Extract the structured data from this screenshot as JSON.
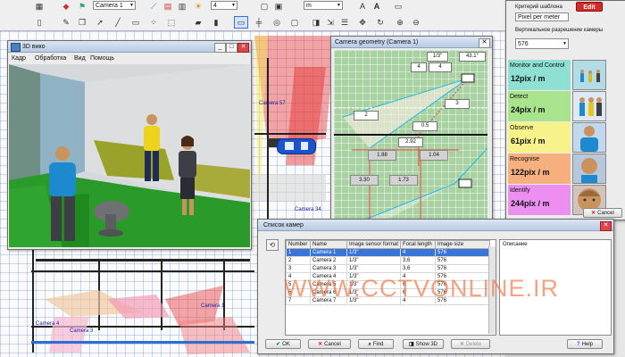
{
  "toolbar": {
    "camera_select": "Camera 1",
    "number_select": "4",
    "unit_select": "m"
  },
  "map": {
    "camera_labels": [
      "Camera 57",
      "Camera 34",
      "Camera 1",
      "Camera 3",
      "Camera 4"
    ]
  },
  "view3d": {
    "title": "3D вико",
    "menu": [
      "Кадр",
      "Обработка",
      "Вид",
      "Помощь"
    ]
  },
  "geometry": {
    "title": "Camera geometry (Camera 1)",
    "sensor": "1/3\"",
    "angle": "43.1°",
    "focal_select": "4",
    "focal_value": "4",
    "height_select": "2",
    "distance_select": "3",
    "value_05": "0.5",
    "value_292": "2.92",
    "value_188": "1.88",
    "value_104": "1.04",
    "value_330": "3.30",
    "value_173": "1.73"
  },
  "criteria": {
    "label": "Критерий шаблона",
    "combo": "Pixel per meter",
    "edit_button": "Edit",
    "resolution_label": "Вертикальное разрешение камеры",
    "resolution_value": "576",
    "levels": [
      {
        "name": "Monitor and Control",
        "value": "12pix / m",
        "color": "#8ee0d2",
        "img": "#b4dce6"
      },
      {
        "name": "Detect",
        "value": "24pix / m",
        "color": "#a9e48c",
        "img": "#dfe9f5"
      },
      {
        "name": "Observe",
        "value": "61pix / m",
        "color": "#f7f28a",
        "img": "#c3d8ec"
      },
      {
        "name": "Recognise",
        "value": "122pix / m",
        "color": "#f6b07e",
        "img": "#b7c8dc"
      },
      {
        "name": "Identify",
        "value": "244pix / m",
        "color": "#ec8ff1",
        "img": "#d2c4bd"
      }
    ],
    "cancel_button": "Cancel"
  },
  "camera_list": {
    "title": "Список камер",
    "columns": [
      "Number",
      "Name",
      "Image sensor format",
      "Focal length",
      "Image size"
    ],
    "rows": [
      [
        "1",
        "Camera 1",
        "1/3\"",
        "4",
        "576"
      ],
      [
        "2",
        "Camera 2",
        "1/3\"",
        "3,6",
        "576"
      ],
      [
        "3",
        "Camera 3",
        "1/3\"",
        "3,6",
        "576"
      ],
      [
        "4",
        "Camera 4",
        "1/3\"",
        "4",
        "576"
      ],
      [
        "5",
        "Camera 5",
        "1/3\"",
        "6",
        "576"
      ],
      [
        "6",
        "Camera 6",
        "1/3\"",
        "6",
        "576"
      ],
      [
        "7",
        "Camera 7",
        "1/3\"",
        "4",
        "576"
      ]
    ],
    "desc_header": "Описание",
    "buttons": {
      "ok": "OK",
      "cancel": "Cancel",
      "find": "Find",
      "show3d": "Show 3D",
      "delete": "Delete",
      "help": "Help"
    }
  },
  "watermark": "WWW.CCTVONLINE.IR",
  "colors": {
    "accent": "#3875d7",
    "edit_button": "#d42a2a",
    "camera_coverage": "#e83a3a",
    "watermark": "#f07a4a"
  }
}
